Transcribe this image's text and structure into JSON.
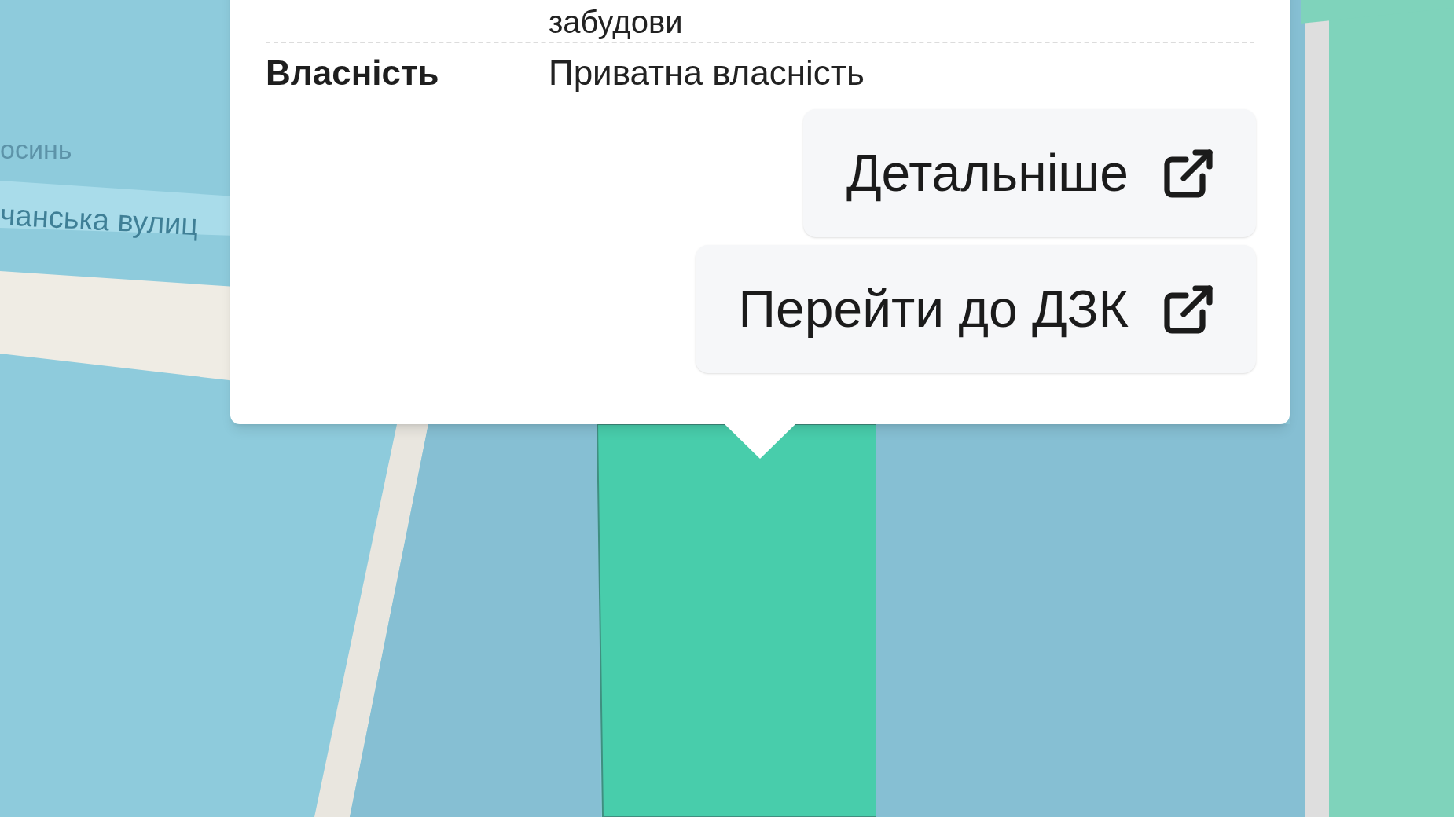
{
  "map": {
    "labels": [
      "осинь",
      "чанська вулиц"
    ]
  },
  "popup": {
    "cut_value": "забудови",
    "rows": [
      {
        "label": "Власність",
        "value": "Приватна власність"
      }
    ],
    "buttons": [
      "Детальніше",
      "Перейти до ДЗК"
    ]
  }
}
